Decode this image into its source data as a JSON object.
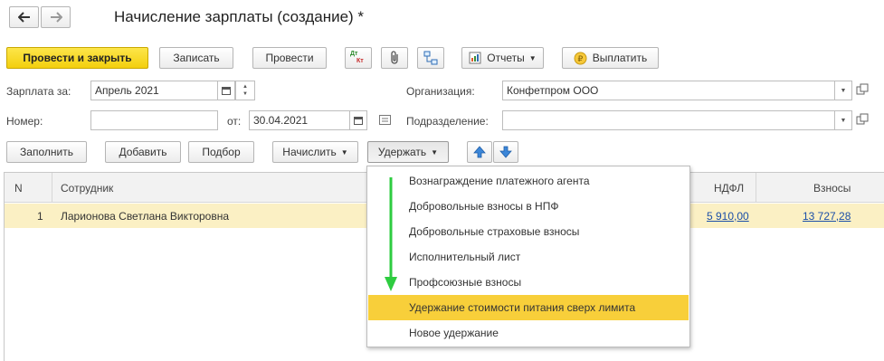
{
  "nav": {
    "back_icon": "arrow-left-icon",
    "forward_icon": "arrow-right-icon"
  },
  "window": {
    "title": "Начисление зарплаты (создание) *"
  },
  "toolbar": {
    "post_close": "Провести и закрыть",
    "save": "Записать",
    "post": "Провести",
    "dtkt_icon_text": {
      "top": "Дт",
      "bottom": "Кт"
    },
    "reports": "Отчеты",
    "pay": "Выплатить"
  },
  "form": {
    "salary_for_label": "Зарплата за:",
    "salary_for_value": "Апрель 2021",
    "org_label": "Организация:",
    "org_value": "Конфетпром ООО",
    "number_label": "Номер:",
    "number_value": "",
    "from_label": "от:",
    "from_value": "30.04.2021",
    "division_label": "Подразделение:",
    "division_value": ""
  },
  "actions": {
    "fill": "Заполнить",
    "add": "Добавить",
    "select": "Подбор",
    "accrue": "Начислить",
    "withhold": "Удержать"
  },
  "table": {
    "columns": {
      "n": "N",
      "employee": "Сотрудник",
      "ndfl": "НДФЛ",
      "contributions": "Взносы"
    },
    "rows": [
      {
        "n": "1",
        "employee": "Ларионова Светлана Викторовна",
        "ndfl": "5 910,00",
        "contributions": "13 727,28"
      }
    ]
  },
  "menu": {
    "items": [
      "Вознаграждение платежного агента",
      "Добровольные взносы в НПФ",
      "Добровольные страховые взносы",
      "Исполнительный лист",
      "Профсоюзные взносы",
      "Удержание стоимости питания сверх лимита",
      "Новое удержание"
    ],
    "active_index": 5
  },
  "colors": {
    "accent_yellow": "#f8cf3a",
    "arrow_green": "#2ecc40",
    "link_blue": "#1c4fa8",
    "row_highlight": "#fbf0c4"
  }
}
